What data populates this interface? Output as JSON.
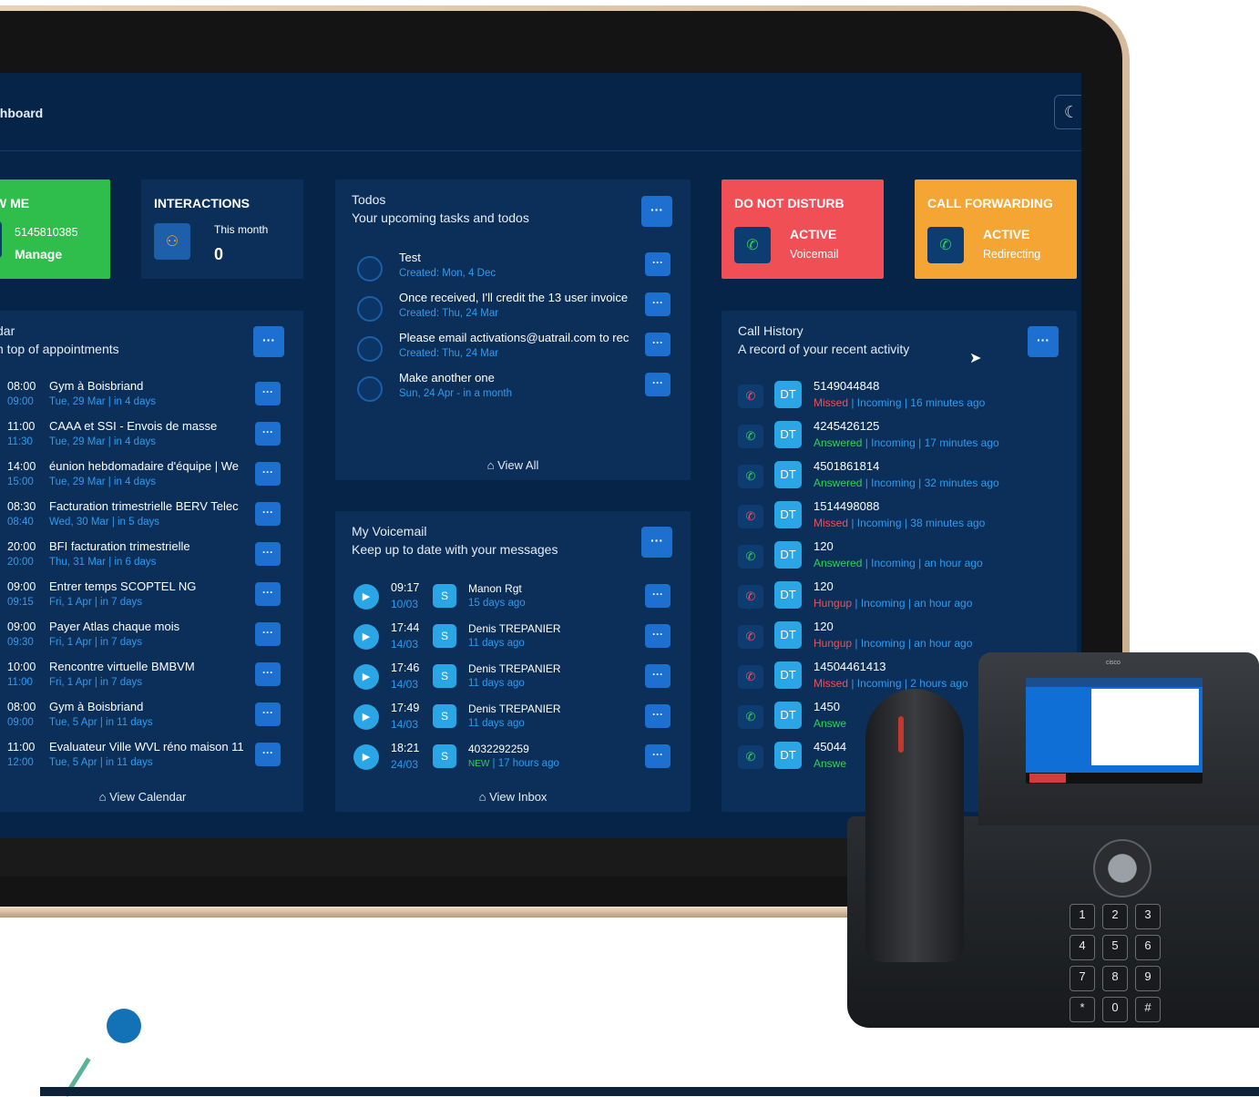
{
  "header": {
    "title": "shboard"
  },
  "cards": {
    "followme": {
      "title": "W ME",
      "number": "5145810385",
      "manage": "Manage",
      "color": "#2fbe4b"
    },
    "interactions": {
      "title": "INTERACTIONS",
      "period": "This month",
      "count": "0"
    },
    "dnd": {
      "title": "DO NOT DISTURB",
      "status": "ACTIVE",
      "mode": "Voicemail",
      "color": "#f05055"
    },
    "cf": {
      "title": "CALL FORWARDING",
      "status": "ACTIVE",
      "mode": "Redirecting",
      "color": "#f4a534"
    }
  },
  "todos": {
    "title": "Todos",
    "subtitle": "Your upcoming tasks and todos",
    "items": [
      {
        "title": "Test",
        "meta": "Created: Mon, 4 Dec"
      },
      {
        "title": "Once received, I'll credit the 13 user invoice",
        "meta": "Created: Thu, 24 Mar"
      },
      {
        "title": "Please email activations@uatrail.com to rec",
        "meta": "Created: Thu, 24 Mar"
      },
      {
        "title": "Make another one",
        "meta": "Sun, 24 Apr - in a month"
      }
    ],
    "footer": "View All"
  },
  "calendar": {
    "title": "dar",
    "subtitle": "n top of appointments",
    "events": [
      {
        "start": "08:00",
        "end": "09:00",
        "title": "Gym à Boisbriand",
        "meta": "Tue, 29 Mar | in 4 days"
      },
      {
        "start": "11:00",
        "end": "11:30",
        "title": "CAAA et SSI - Envois de masse",
        "meta": "Tue, 29 Mar | in 4 days"
      },
      {
        "start": "14:00",
        "end": "15:00",
        "title": "éunion hebdomadaire d'équipe | We",
        "meta": "Tue, 29 Mar | in 4 days"
      },
      {
        "start": "08:30",
        "end": "08:40",
        "title": "Facturation trimestrielle BERV Telec",
        "meta": "Wed, 30 Mar | in 5 days"
      },
      {
        "start": "20:00",
        "end": "20:00",
        "title": "BFI facturation trimestrielle",
        "meta": "Thu, 31 Mar | in 6 days"
      },
      {
        "start": "09:00",
        "end": "09:15",
        "title": "Entrer temps SCOPTEL NG",
        "meta": "Fri, 1 Apr | in 7 days"
      },
      {
        "start": "09:00",
        "end": "09:30",
        "title": "Payer Atlas chaque mois",
        "meta": "Fri, 1 Apr | in 7 days"
      },
      {
        "start": "10:00",
        "end": "11:00",
        "title": "Rencontre virtuelle BMBVM",
        "meta": "Fri, 1 Apr | in 7 days"
      },
      {
        "start": "08:00",
        "end": "09:00",
        "title": "Gym à Boisbriand",
        "meta": "Tue, 5 Apr | in 11 days"
      },
      {
        "start": "11:00",
        "end": "12:00",
        "title": "Evaluateur Ville WVL réno maison 11",
        "meta": "Tue, 5 Apr | in 11 days"
      }
    ],
    "footer": "View Calendar"
  },
  "voicemail": {
    "title": "My Voicemail",
    "subtitle": "Keep up to date with your messages",
    "messages": [
      {
        "time": "09:17",
        "date": "10/03",
        "from": "Manon Rgt",
        "age": "15 days ago",
        "new": ""
      },
      {
        "time": "17:44",
        "date": "14/03",
        "from": "Denis TREPANIER",
        "age": "11 days ago",
        "new": ""
      },
      {
        "time": "17:46",
        "date": "14/03",
        "from": "Denis TREPANIER",
        "age": "11 days ago",
        "new": ""
      },
      {
        "time": "17:49",
        "date": "14/03",
        "from": "Denis TREPANIER",
        "age": "11 days ago",
        "new": ""
      },
      {
        "time": "18:21",
        "date": "24/03",
        "from": "4032292259",
        "age": " | 17 hours ago",
        "new": "NEW"
      }
    ],
    "avatar": "S",
    "footer": "View Inbox"
  },
  "calls": {
    "title": "Call History",
    "subtitle": "A record of your recent activity",
    "avatar": "DT",
    "items": [
      {
        "number": "5149044848",
        "status": "Missed",
        "rest": " | Incoming | 16 minutes ago"
      },
      {
        "number": "4245426125",
        "status": "Answered",
        "rest": " | Incoming | 17 minutes ago"
      },
      {
        "number": "4501861814",
        "status": "Answered",
        "rest": " | Incoming | 32 minutes ago"
      },
      {
        "number": "1514498088",
        "status": "Missed",
        "rest": " | Incoming | 38 minutes ago"
      },
      {
        "number": "120",
        "status": "Answered",
        "rest": " | Incoming | an hour ago"
      },
      {
        "number": "120",
        "status": "Hungup",
        "rest": " | Incoming | an hour ago"
      },
      {
        "number": "120",
        "status": "Hungup",
        "rest": " | Incoming | an hour ago"
      },
      {
        "number": "14504461413",
        "status": "Missed",
        "rest": " | Incoming | 2 hours ago"
      },
      {
        "number": "1450",
        "status": "Answe",
        "rest": ""
      },
      {
        "number": "45044",
        "status": "Answe",
        "rest": ""
      }
    ],
    "colors": {
      "Missed": "#f0505a",
      "Answered": "#2fd05a",
      "Hungup": "#f0505a",
      "Answe": "#2fd05a"
    }
  },
  "phone": {
    "brand": "cisco",
    "keys": [
      "1",
      "2",
      "3",
      "4",
      "5",
      "6",
      "7",
      "8",
      "9",
      "*",
      "0",
      "#"
    ]
  }
}
